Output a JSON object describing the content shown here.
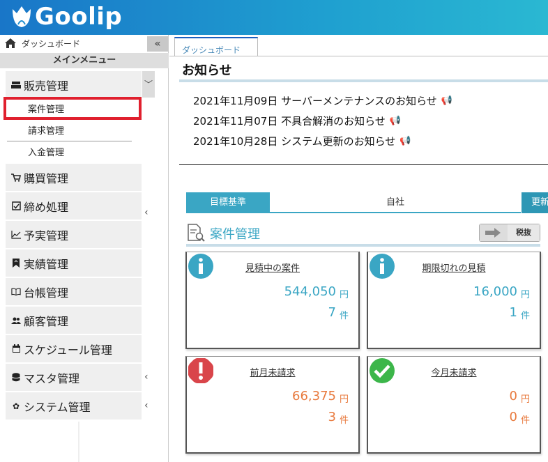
{
  "app": {
    "name": "Goolip"
  },
  "sidebar": {
    "dashboard_label": "ダッシュボード",
    "collapse_glyph": "«",
    "main_menu_title": "メインメニュー",
    "sales": {
      "label": "販売管理",
      "sub": [
        "案件管理",
        "請求管理",
        "入金管理"
      ]
    },
    "items": [
      {
        "label": "購買管理",
        "icon": "cart-icon",
        "has_chevron": true
      },
      {
        "label": "締め処理",
        "icon": "checkbox-icon",
        "has_chevron": false
      },
      {
        "label": "予実管理",
        "icon": "line-chart-icon",
        "has_chevron": false
      },
      {
        "label": "実績管理",
        "icon": "bookmark-icon",
        "has_chevron": false
      },
      {
        "label": "台帳管理",
        "icon": "book-icon",
        "has_chevron": false
      },
      {
        "label": "顧客管理",
        "icon": "users-icon",
        "has_chevron": false
      },
      {
        "label": "スケジュール管理",
        "icon": "calendar-icon",
        "has_chevron": false
      },
      {
        "label": "マスタ管理",
        "icon": "database-icon",
        "has_chevron": true
      },
      {
        "label": "システム管理",
        "icon": "gear-icon",
        "has_chevron": true
      }
    ]
  },
  "main": {
    "tab_label": "ダッシュボード",
    "notice_title": "お知らせ",
    "news": [
      "2021年11月09日 サーバーメンテナンスのお知らせ",
      "2021年11月07日 不具合解消のお知らせ",
      "2021年10月28日 システム更新のお知らせ"
    ],
    "toggle": {
      "left": "目標基準",
      "mid": "自社",
      "right": "更新"
    },
    "section_title": "案件管理",
    "tax_label": "税抜",
    "cards": [
      {
        "title": "見積中の案件",
        "amount": "544,050",
        "amount_unit": "円",
        "count": "7",
        "count_unit": "件",
        "icon": "info-icon",
        "color": "#3aa6c4"
      },
      {
        "title": "期限切れの見積",
        "amount": "16,000",
        "amount_unit": "円",
        "count": "1",
        "count_unit": "件",
        "icon": "info-icon",
        "color": "#3aa6c4"
      },
      {
        "title": "前月未請求",
        "amount": "66,375",
        "amount_unit": "円",
        "count": "3",
        "count_unit": "件",
        "icon": "alert-icon",
        "color": "#e87a3e"
      },
      {
        "title": "今月未請求",
        "amount": "0",
        "amount_unit": "円",
        "count": "0",
        "count_unit": "件",
        "icon": "check-icon",
        "color": "#e87a3e"
      }
    ]
  }
}
